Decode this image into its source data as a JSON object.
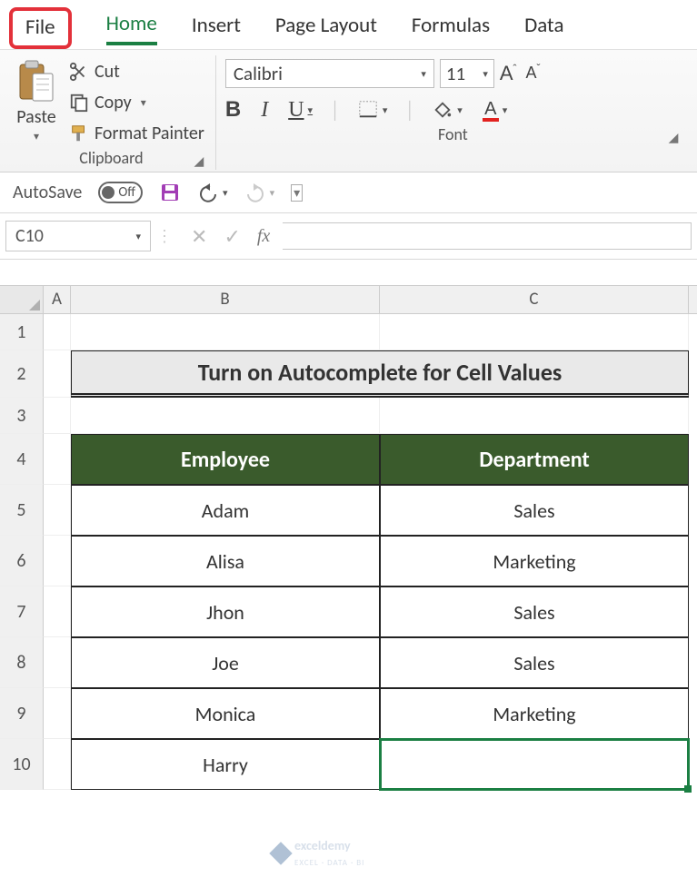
{
  "tabs": {
    "file": "File",
    "home": "Home",
    "insert": "Insert",
    "page_layout": "Page Layout",
    "formulas": "Formulas",
    "data": "Data"
  },
  "clipboard": {
    "paste": "Paste",
    "cut": "Cut",
    "copy": "Copy",
    "format_painter": "Format Painter",
    "group_label": "Clipboard"
  },
  "font": {
    "name": "Calibri",
    "size": "11",
    "group_label": "Font",
    "bold": "B",
    "italic": "I",
    "underline": "U"
  },
  "qat": {
    "autosave_label": "AutoSave",
    "autosave_state": "Off"
  },
  "formula_bar": {
    "namebox": "C10",
    "fx": "fx"
  },
  "colheads": {
    "A": "A",
    "B": "B",
    "C": "C"
  },
  "rowheads": [
    "1",
    "2",
    "3",
    "4",
    "5",
    "6",
    "7",
    "8",
    "9",
    "10"
  ],
  "sheet": {
    "title": "Turn on Autocomplete for Cell Values",
    "table": {
      "headers": {
        "employee": "Employee",
        "department": "Department"
      },
      "rows": [
        {
          "employee": "Adam",
          "department": "Sales"
        },
        {
          "employee": "Alisa",
          "department": "Marketing"
        },
        {
          "employee": "Jhon",
          "department": "Sales"
        },
        {
          "employee": "Joe",
          "department": "Sales"
        },
        {
          "employee": "Monica",
          "department": "Marketing"
        },
        {
          "employee": "Harry",
          "department": ""
        }
      ]
    }
  },
  "watermark": {
    "brand": "exceldemy",
    "tagline": "EXCEL · DATA · BI"
  }
}
